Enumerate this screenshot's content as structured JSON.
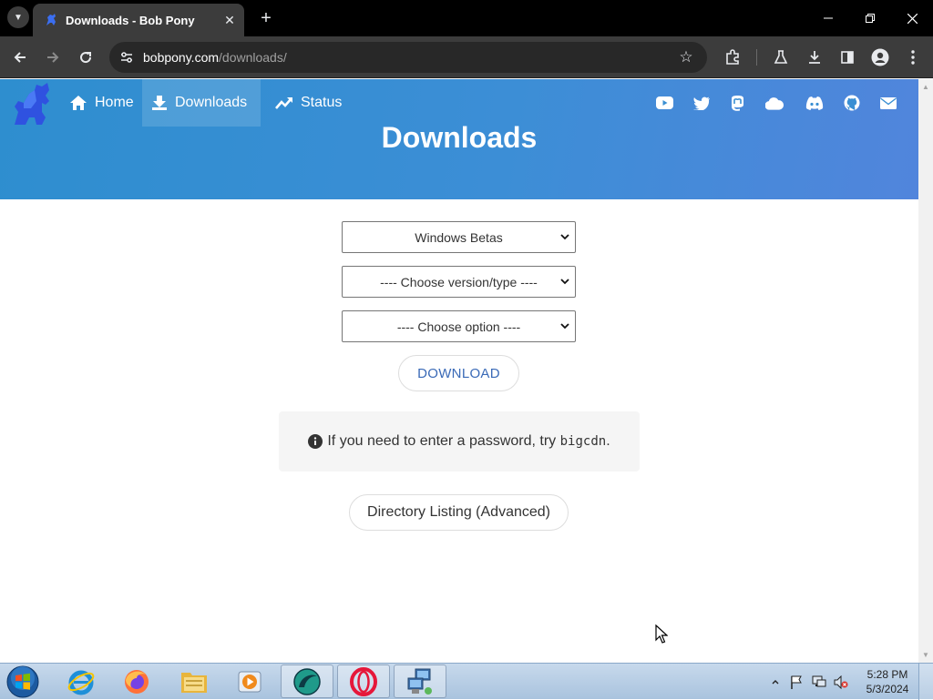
{
  "browser": {
    "tab_title": "Downloads - Bob Pony",
    "url_host": "bobpony.com",
    "url_path": "/downloads/"
  },
  "page": {
    "nav": [
      {
        "label": "Home",
        "icon": "home-icon"
      },
      {
        "label": "Downloads",
        "icon": "download-icon",
        "active": true
      },
      {
        "label": "Status",
        "icon": "trending-up-icon"
      }
    ],
    "social_icons": [
      "youtube-icon",
      "twitter-icon",
      "mastodon-icon",
      "cloud-icon",
      "discord-icon",
      "github-icon",
      "mail-icon"
    ],
    "title": "Downloads",
    "selects": {
      "category": "Windows Betas",
      "version": "---- Choose version/type ----",
      "option": "---- Choose option ----"
    },
    "download_button": "DOWNLOAD",
    "info": {
      "text": "If you need to enter a password, try ",
      "code": "bigcdn",
      "suffix": "."
    },
    "directory_button": "Directory Listing (Advanced)"
  },
  "taskbar": {
    "apps": [
      "internet-explorer-icon",
      "firefox-icon",
      "file-explorer-icon",
      "media-player-icon",
      "app-icon",
      "opera-icon",
      "network-app-icon"
    ],
    "time": "5:28 PM",
    "date": "5/3/2024"
  },
  "colors": {
    "hero_start": "#2e8ecf",
    "hero_end": "#5185dc",
    "link_blue": "#3a6ab7",
    "browser_dark": "#3c3c3c"
  }
}
